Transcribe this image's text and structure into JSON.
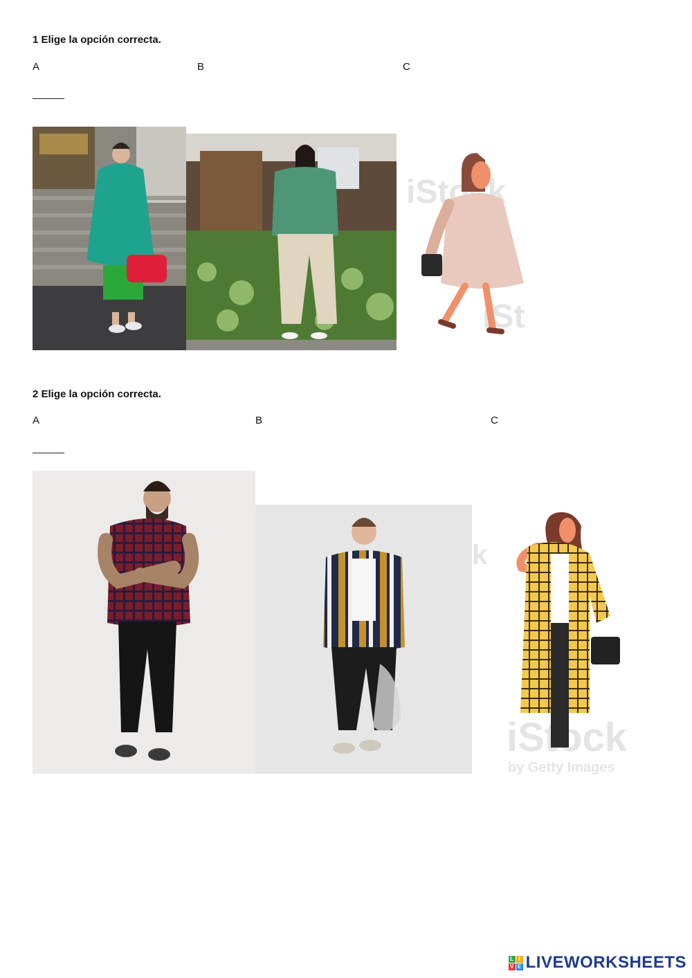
{
  "questions": [
    {
      "title": "1 Elige la opción correcta.",
      "options": [
        "A",
        "B",
        "C"
      ]
    },
    {
      "title": "2 Elige la opción correcta.",
      "options": [
        "A",
        "B",
        "C"
      ]
    }
  ],
  "watermark": {
    "brand": "iStock",
    "sub": "by Getty Images"
  },
  "footer": {
    "logo_text": "LIVEWORKSHEETS",
    "logo_letters": [
      "L",
      "I",
      "V",
      "E"
    ],
    "brand_color": "#1f3a8f"
  },
  "images": {
    "q1": [
      "woman-teal-sweater-photo",
      "woman-green-top-beige-pants-photo",
      "woman-pink-dress-illustration"
    ],
    "q2": [
      "man-plaid-shirt-photo",
      "man-striped-shirt-photo",
      "woman-yellow-check-coat-illustration"
    ]
  }
}
